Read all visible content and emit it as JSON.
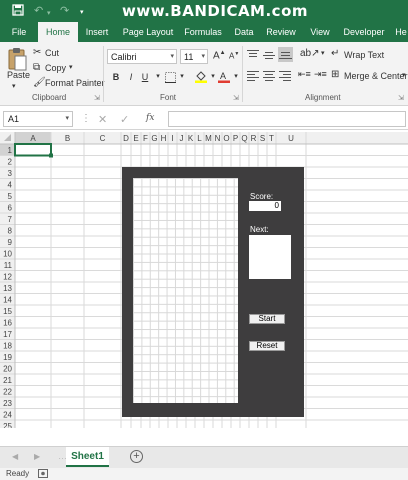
{
  "titlebar": {
    "watermark": "www.BANDICAM.com",
    "save_icon": "save-icon",
    "undo_icon": "undo-icon",
    "redo_icon": "redo-icon"
  },
  "tabs": [
    "File",
    "Home",
    "Insert",
    "Page Layout",
    "Formulas",
    "Data",
    "Review",
    "View",
    "Developer",
    "He"
  ],
  "active_tab": "Home",
  "ribbon": {
    "clipboard": {
      "paste": "Paste",
      "cut": "Cut",
      "copy": "Copy",
      "format_painter": "Format Painter",
      "label": "Clipboard"
    },
    "font": {
      "family": "Calibri",
      "size": "11",
      "bold": "B",
      "italic": "I",
      "underline": "U",
      "grow": "A",
      "shrink": "A",
      "label": "Font"
    },
    "alignment": {
      "wrap_text": "Wrap Text",
      "merge_center": "Merge & Center",
      "label": "Alignment"
    }
  },
  "formula_bar": {
    "name_box": "A1",
    "fx": "fx",
    "value": ""
  },
  "grid": {
    "columns": [
      "A",
      "B",
      "C",
      "D",
      "E",
      "F",
      "G",
      "H",
      "I",
      "J",
      "K",
      "L",
      "M",
      "N",
      "O",
      "P",
      "Q",
      "R",
      "S",
      "T",
      "U"
    ],
    "rows": [
      "1",
      "2",
      "3",
      "4",
      "5",
      "6",
      "7",
      "8",
      "9",
      "10",
      "11",
      "12",
      "13",
      "14",
      "15",
      "16",
      "17",
      "18",
      "19",
      "20",
      "21",
      "22",
      "23",
      "24",
      "25"
    ],
    "selected_cell": "A1"
  },
  "game": {
    "score_label": "Score:",
    "score_value": "0",
    "next_label": "Next:",
    "start_label": "Start",
    "reset_label": "Reset",
    "panel_color": "#3e3d3e"
  },
  "sheets": {
    "tabs": [
      "Sheet1"
    ],
    "add_icon": "plus-icon"
  },
  "status": {
    "text": "Ready"
  },
  "colors": {
    "accent": "#217346"
  }
}
